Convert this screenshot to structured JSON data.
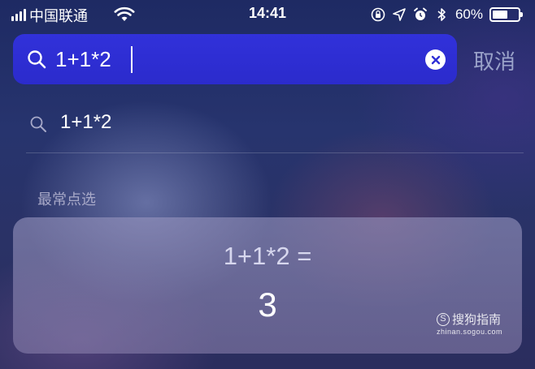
{
  "status_bar": {
    "carrier": "中国联通",
    "time": "14:41",
    "battery_percent_text": "60%",
    "battery_level": 0.6
  },
  "search": {
    "query": "1+1*2",
    "cancel_label": "取消"
  },
  "suggestion": {
    "text": "1+1*2"
  },
  "section": {
    "title": "最常点选"
  },
  "calculator": {
    "expression": "1+1*2 =",
    "result": "3"
  },
  "watermark": {
    "logo_letter": "S",
    "brand": "搜狗指南",
    "url": "zhinan.sogou.com"
  },
  "colors": {
    "search_bar": "#2f2fd6",
    "cancel": "#9aa2c9"
  },
  "icons": {
    "signal": "signal-bars-icon",
    "wifi": "wifi-icon",
    "rotation_lock": "rotation-lock-icon",
    "location": "location-arrow-icon",
    "alarm": "alarm-icon",
    "bluetooth": "bluetooth-icon",
    "battery": "battery-icon",
    "search": "magnifier-icon",
    "clear": "clear-x-icon"
  }
}
